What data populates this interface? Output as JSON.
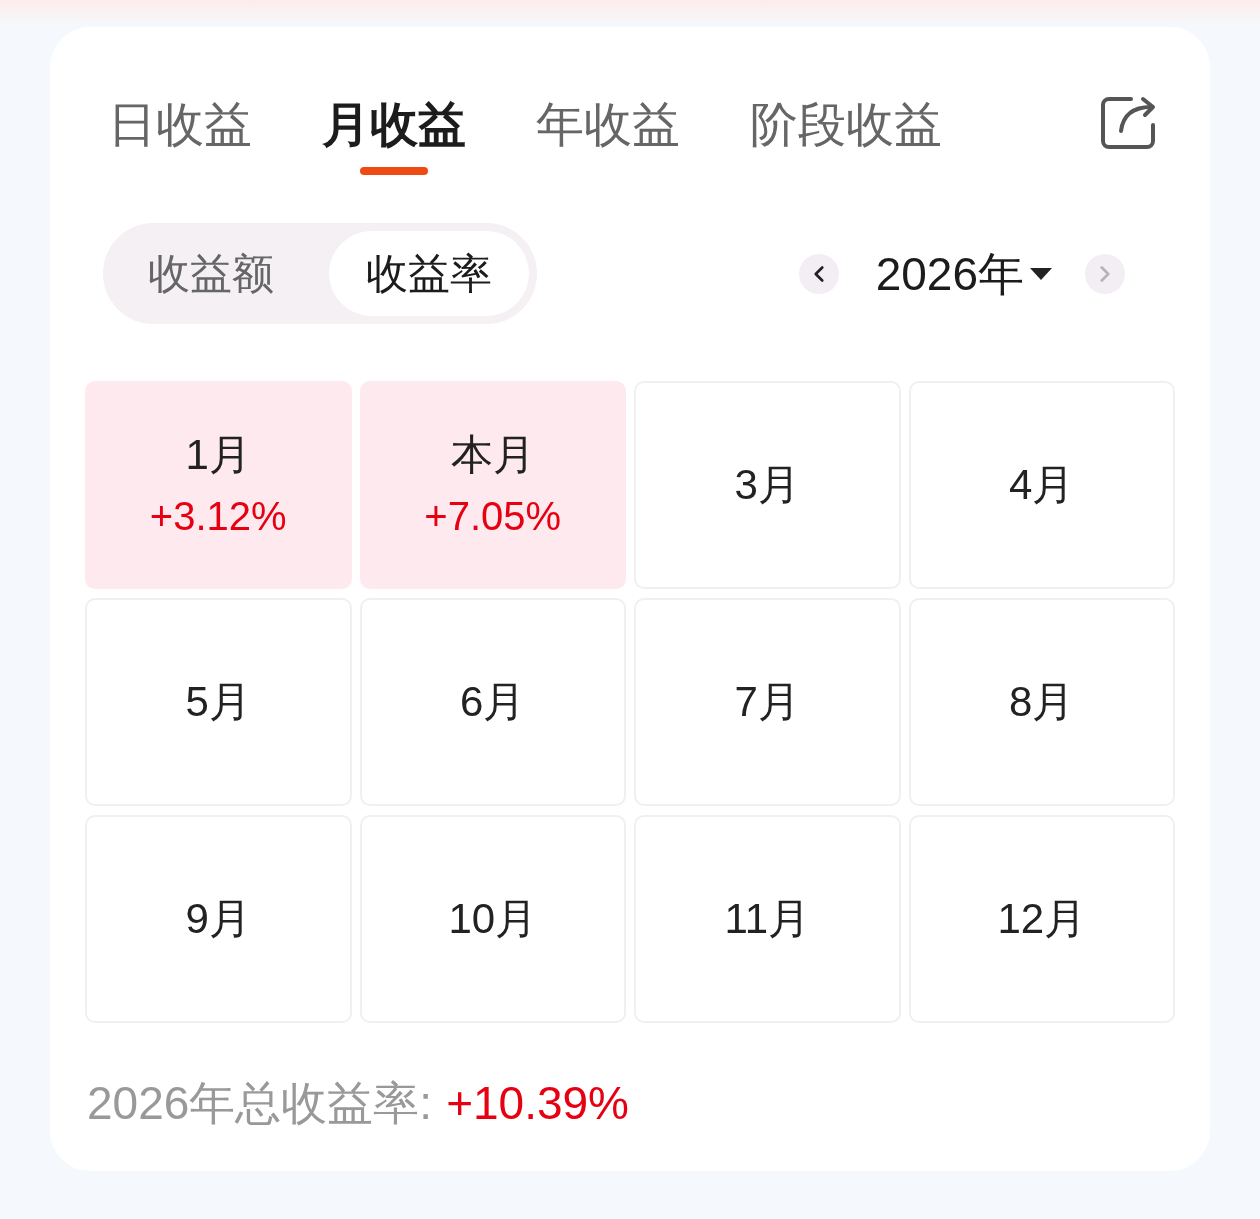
{
  "top_tabs": [
    {
      "label": "日收益",
      "selected": false
    },
    {
      "label": "月收益",
      "selected": true
    },
    {
      "label": "年收益",
      "selected": false
    },
    {
      "label": "阶段收益",
      "selected": false
    }
  ],
  "mode_toggle": [
    {
      "label": "收益额",
      "selected": false
    },
    {
      "label": "收益率",
      "selected": true
    }
  ],
  "year_picker": {
    "label": "2026年",
    "prev": {
      "disabled": false
    },
    "next": {
      "disabled": true
    }
  },
  "months": [
    {
      "label": "1月",
      "value": "+3.12%",
      "highlighted": true
    },
    {
      "label": "本月",
      "value": "+7.05%",
      "highlighted": true
    },
    {
      "label": "3月",
      "highlighted": false
    },
    {
      "label": "4月",
      "highlighted": false
    },
    {
      "label": "5月",
      "highlighted": false
    },
    {
      "label": "6月",
      "highlighted": false
    },
    {
      "label": "7月",
      "highlighted": false
    },
    {
      "label": "8月",
      "highlighted": false
    },
    {
      "label": "9月",
      "highlighted": false
    },
    {
      "label": "10月",
      "highlighted": false
    },
    {
      "label": "11月",
      "highlighted": false
    },
    {
      "label": "12月",
      "highlighted": false
    }
  ],
  "summary": {
    "label": "2026年总收益率:",
    "value": "+10.39%"
  }
}
